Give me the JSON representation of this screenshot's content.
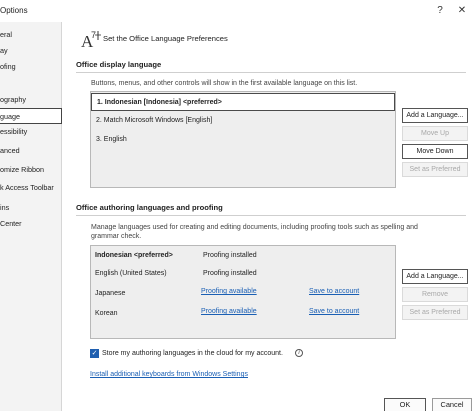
{
  "window": {
    "title": "Options",
    "help_glyph": "?",
    "close_glyph": "✕"
  },
  "sidebar": {
    "items": [
      {
        "label": "eral"
      },
      {
        "label": "ay"
      },
      {
        "label": "ofing"
      },
      {
        "label": "ography"
      },
      {
        "label": "guage"
      },
      {
        "label": "essibility"
      },
      {
        "label": "anced"
      },
      {
        "label": "omize Ribbon"
      },
      {
        "label": "k Access Toolbar"
      },
      {
        "label": "ins"
      },
      {
        "label": "Center"
      }
    ],
    "selected_index": 4
  },
  "header": {
    "title": "Set the Office Language Preferences",
    "icon": "language-icon"
  },
  "display": {
    "section_title": "Office display language",
    "description": "Buttons, menus, and other controls will show in the first available language on this list.",
    "items": [
      {
        "label": "1.   Indonesian [Indonesia] <preferred>"
      },
      {
        "label": "2.   Match Microsoft Windows [English]"
      },
      {
        "label": "3.   English"
      }
    ],
    "buttons": {
      "add": "Add a Language...",
      "move_up": "Move Up",
      "move_down": "Move Down",
      "set_preferred": "Set as Preferred"
    }
  },
  "authoring": {
    "section_title": "Office authoring languages and proofing",
    "description_line1": "Manage languages used for creating and editing documents, including proofing tools such as spelling and",
    "description_line2": "grammar check.",
    "rows": [
      {
        "language": "Indonesian <preferred>",
        "status": "Proofing installed",
        "action": ""
      },
      {
        "language": "English (United States)",
        "status": "Proofing installed",
        "action": ""
      },
      {
        "language": "Japanese",
        "status": "Proofing available",
        "action": "Save to account"
      },
      {
        "language": "Korean",
        "status": "Proofing available",
        "action": "Save to account"
      }
    ],
    "buttons": {
      "add": "Add a Language...",
      "remove": "Remove",
      "set_preferred": "Set as Preferred"
    },
    "store_checkbox_label": "Store my authoring languages in the cloud for my account.",
    "install_link": "Install additional keyboards from Windows Settings"
  },
  "footer": {
    "ok": "OK",
    "cancel": "Cancel"
  },
  "info_glyph": "i",
  "check_glyph": "✓"
}
